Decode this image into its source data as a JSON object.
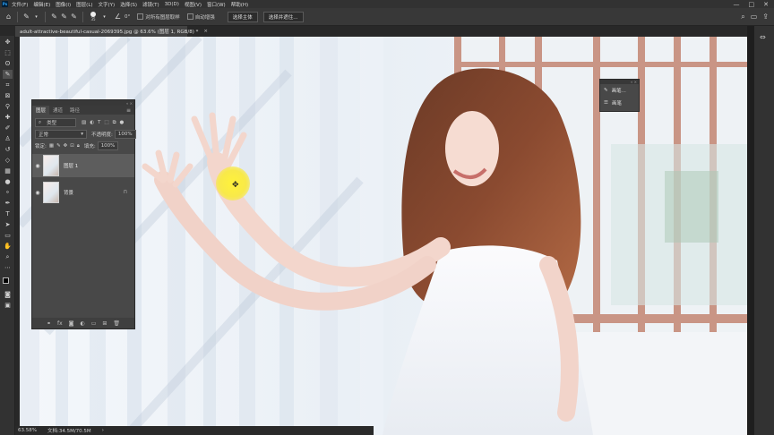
{
  "menu": {
    "app_icon": "Ps",
    "items": [
      "文件(F)",
      "编辑(E)",
      "图像(I)",
      "图层(L)",
      "文字(Y)",
      "选择(S)",
      "滤镜(T)",
      "3D(D)",
      "视图(V)",
      "窗口(W)",
      "帮助(H)"
    ],
    "window_controls": [
      "—",
      "□",
      "✕"
    ]
  },
  "options": {
    "brush_size": "35",
    "angle": "0°",
    "sample_all_layers": "对所有图层取样",
    "auto_enhance": "自动增强",
    "select_subject": "选择主体",
    "select_and_mask": "选择并遮住..."
  },
  "document": {
    "tab_title": "adult-attractive-beautiful-casual-2069395.jpg @ 63.6% (图层 1, RGB/8) *",
    "close": "×"
  },
  "status": {
    "zoom": "63.58%",
    "doc_size": "文档:34.5M/70.5M",
    "arrow": "›"
  },
  "layers_panel": {
    "tabs": [
      "图层",
      "通道",
      "路径"
    ],
    "menu_icon": "≡",
    "filter_label": "类型",
    "blend_mode": "正常",
    "opacity_label": "不透明度:",
    "opacity_value": "100%",
    "lock_label": "锁定:",
    "fill_label": "填充:",
    "fill_value": "100%",
    "layers": [
      {
        "name": "图层 1",
        "visible": true,
        "active": true
      },
      {
        "name": "背景",
        "visible": true,
        "active": false,
        "locked": true
      }
    ]
  },
  "brush_panel": {
    "items": [
      "画笔...",
      "画笔"
    ]
  },
  "colors": {
    "ui_dark": "#323232",
    "panel": "#484848",
    "cursor_highlight": "#f8e94a"
  }
}
